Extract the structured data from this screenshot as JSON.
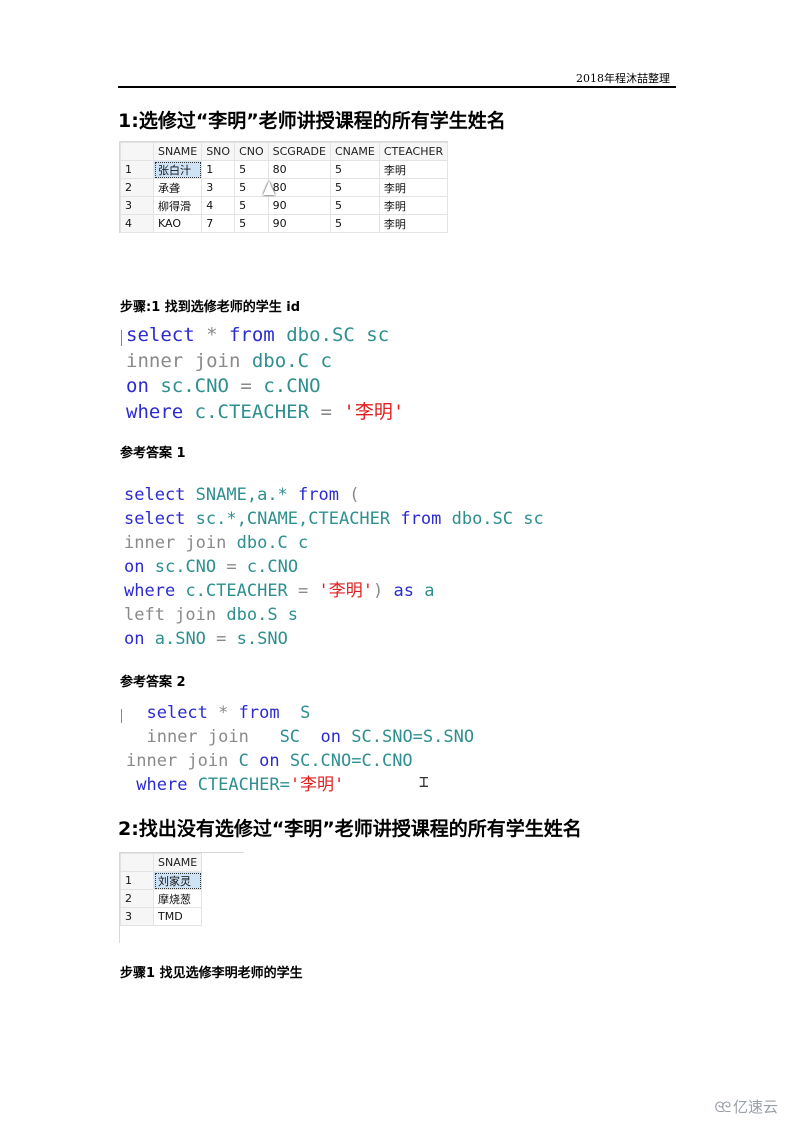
{
  "header": {
    "text": "2018年程沐喆整理"
  },
  "section1": {
    "title": "1:选修过“李明”老师讲授课程的所有学生姓名",
    "result_table": {
      "columns": [
        "",
        "SNAME",
        "SNO",
        "CNO",
        "SCGRADE",
        "CNAME",
        "CTEACHER"
      ],
      "rows": [
        [
          "1",
          "张白汁",
          "1",
          "5",
          "80",
          "5",
          "李明"
        ],
        [
          "2",
          "承聋",
          "3",
          "5",
          "80",
          "5",
          "李明"
        ],
        [
          "3",
          "柳得滑",
          "4",
          "5",
          "90",
          "5",
          "李明"
        ],
        [
          "4",
          "KAO",
          "7",
          "5",
          "90",
          "5",
          "李明"
        ]
      ]
    },
    "step1": {
      "label": "步骤:1 找到选修老师的学生 id",
      "code": [
        [
          [
            "kw",
            "select"
          ],
          [
            "op",
            " * "
          ],
          [
            "kw",
            "from"
          ],
          [
            "op",
            " "
          ],
          [
            "teal",
            "dbo.SC sc"
          ]
        ],
        [
          [
            "gray",
            "inner join"
          ],
          [
            "op",
            " "
          ],
          [
            "teal",
            "dbo.C c"
          ]
        ],
        [
          [
            "kw",
            "on"
          ],
          [
            "op",
            " "
          ],
          [
            "teal",
            "sc.CNO"
          ],
          [
            "op",
            " = "
          ],
          [
            "teal",
            "c.CNO"
          ]
        ],
        [
          [
            "kw",
            "where"
          ],
          [
            "op",
            " "
          ],
          [
            "teal",
            "c.CTEACHER"
          ],
          [
            "op",
            " = "
          ],
          [
            "red",
            "'李明'"
          ]
        ]
      ]
    },
    "answer1": {
      "label": "参考答案 1",
      "code": [
        [
          [
            "kw",
            "select"
          ],
          [
            "op",
            " "
          ],
          [
            "teal",
            "SNAME,a.*"
          ],
          [
            "op",
            " "
          ],
          [
            "kw",
            "from"
          ],
          [
            "op",
            " ("
          ]
        ],
        [
          [
            "kw",
            "select"
          ],
          [
            "op",
            " "
          ],
          [
            "teal",
            "sc.*,CNAME,CTEACHER"
          ],
          [
            "op",
            " "
          ],
          [
            "kw",
            "from"
          ],
          [
            "op",
            " "
          ],
          [
            "teal",
            "dbo.SC sc"
          ]
        ],
        [
          [
            "gray",
            "inner join"
          ],
          [
            "op",
            " "
          ],
          [
            "teal",
            "dbo.C c"
          ]
        ],
        [
          [
            "kw",
            "on"
          ],
          [
            "op",
            " "
          ],
          [
            "teal",
            "sc.CNO"
          ],
          [
            "op",
            " = "
          ],
          [
            "teal",
            "c.CNO"
          ]
        ],
        [
          [
            "kw",
            "where"
          ],
          [
            "op",
            " "
          ],
          [
            "teal",
            "c.CTEACHER"
          ],
          [
            "op",
            " = "
          ],
          [
            "red",
            "'李明'"
          ],
          [
            "op",
            ") "
          ],
          [
            "kw",
            "as"
          ],
          [
            "op",
            " "
          ],
          [
            "teal",
            "a"
          ]
        ],
        [
          [
            "gray",
            "left join"
          ],
          [
            "op",
            " "
          ],
          [
            "teal",
            "dbo.S s"
          ]
        ],
        [
          [
            "kw",
            "on"
          ],
          [
            "op",
            " "
          ],
          [
            "teal",
            "a.SNO"
          ],
          [
            "op",
            " = "
          ],
          [
            "teal",
            "s.SNO"
          ]
        ]
      ]
    },
    "answer2": {
      "label": "参考答案 2",
      "code": [
        [
          [
            "op",
            "  "
          ],
          [
            "kw",
            "select"
          ],
          [
            "op",
            " * "
          ],
          [
            "kw",
            "from"
          ],
          [
            "op",
            "  "
          ],
          [
            "teal",
            "S"
          ]
        ],
        [
          [
            "op",
            "  "
          ],
          [
            "gray",
            "inner join"
          ],
          [
            "op",
            "   "
          ],
          [
            "teal",
            "SC"
          ],
          [
            "op",
            "  "
          ],
          [
            "kw",
            "on"
          ],
          [
            "op",
            " "
          ],
          [
            "teal",
            "SC.SNO=S.SNO"
          ]
        ],
        [
          [
            "gray",
            "inner join"
          ],
          [
            "op",
            " "
          ],
          [
            "teal",
            "C"
          ],
          [
            "op",
            " "
          ],
          [
            "kw",
            "on"
          ],
          [
            "op",
            " "
          ],
          [
            "teal",
            "SC.CNO=C.CNO"
          ]
        ],
        [
          [
            "op",
            " "
          ],
          [
            "kw",
            "where"
          ],
          [
            "op",
            " "
          ],
          [
            "teal",
            "CTEACHER="
          ],
          [
            "red",
            "'李明'"
          ]
        ]
      ]
    }
  },
  "section2": {
    "title": "2:找出没有选修过“李明”老师讲授课程的所有学生姓名",
    "result_table": {
      "columns": [
        "",
        "SNAME"
      ],
      "rows": [
        [
          "1",
          "刘家灵"
        ],
        [
          "2",
          "摩烧葱"
        ],
        [
          "3",
          "TMD"
        ]
      ]
    },
    "step1": {
      "label": "步骤1 找见选修李明老师的学生"
    }
  },
  "watermark": {
    "text": "亿速云"
  }
}
